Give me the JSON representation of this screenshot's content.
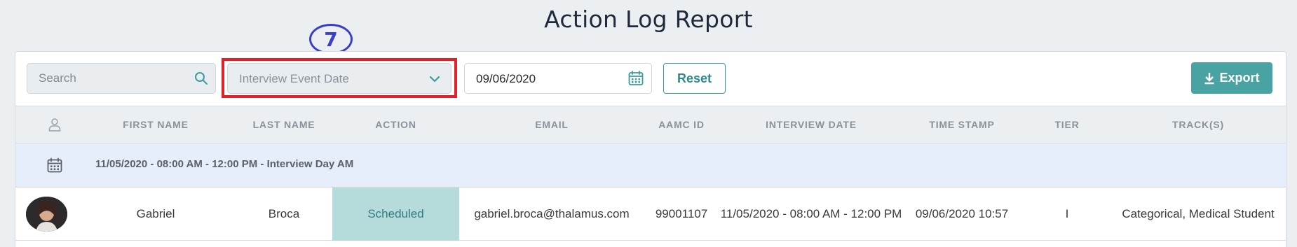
{
  "page": {
    "title": "Action Log Report"
  },
  "annotation": {
    "step_number": "7"
  },
  "toolbar": {
    "search_placeholder": "Search",
    "filter_dropdown_label": "Interview Event Date",
    "date_value": "09/06/2020",
    "reset_label": "Reset",
    "export_label": "Export"
  },
  "table": {
    "columns": [
      "FIRST NAME",
      "LAST NAME",
      "ACTION",
      "EMAIL",
      "AAMC ID",
      "INTERVIEW DATE",
      "TIME STAMP",
      "TIER",
      "TRACK(S)"
    ],
    "group_label": "11/05/2020 - 08:00 AM - 12:00 PM - Interview Day AM",
    "rows": [
      {
        "first_name": "Gabriel",
        "last_name": "Broca",
        "action": "Scheduled",
        "email": "gabriel.broca@thalamus.com",
        "aamc_id": "99001107",
        "interview_date": "11/05/2020 - 08:00 AM - 12:00 PM",
        "time_stamp": "09/06/2020 10:57",
        "tier": "I",
        "tracks": "Categorical, Medical Student"
      }
    ]
  },
  "colors": {
    "accent": "#4aa3a3",
    "highlight_border": "#e3202a",
    "annotation": "#3b3fc4",
    "action_scheduled_bg": "#b5dcdb",
    "group_row_bg": "#e6eefb"
  },
  "icons": [
    "search-icon",
    "chevron-down-icon",
    "calendar-icon",
    "download-icon",
    "person-icon"
  ]
}
